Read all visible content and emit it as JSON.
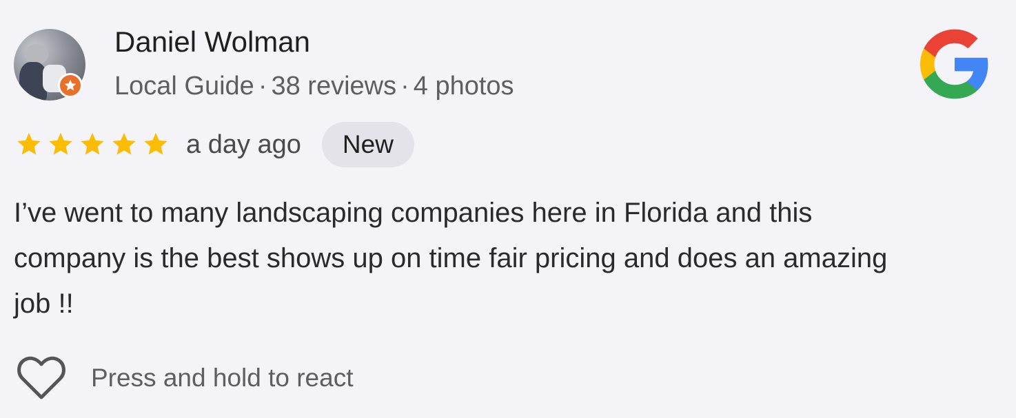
{
  "review": {
    "author": {
      "name": "Daniel Wolman",
      "role": "Local Guide",
      "reviews_count": "38 reviews",
      "photos_count": "4 photos",
      "separator": "·",
      "avatar_icon": "user-avatar-photo",
      "badge_icon": "local-guide-star-icon"
    },
    "source_icon": "google-g-logo",
    "rating": 5,
    "rating_max": 5,
    "date": "a day ago",
    "badge": "New",
    "text": "I’ve went to many landscaping companies here in Florida and this company is the best shows up on time fair pricing and does an amazing job !!",
    "react": {
      "icon": "heart-outline-icon",
      "label": "Press and hold to react"
    }
  },
  "colors": {
    "background": "#f4f3f8",
    "star": "#fbbc04",
    "guide_badge": "#e8702a",
    "badge_bg": "#e4e3e9",
    "google_blue": "#4285f4",
    "google_red": "#ea4335",
    "google_yellow": "#fbbc05",
    "google_green": "#34a853"
  }
}
